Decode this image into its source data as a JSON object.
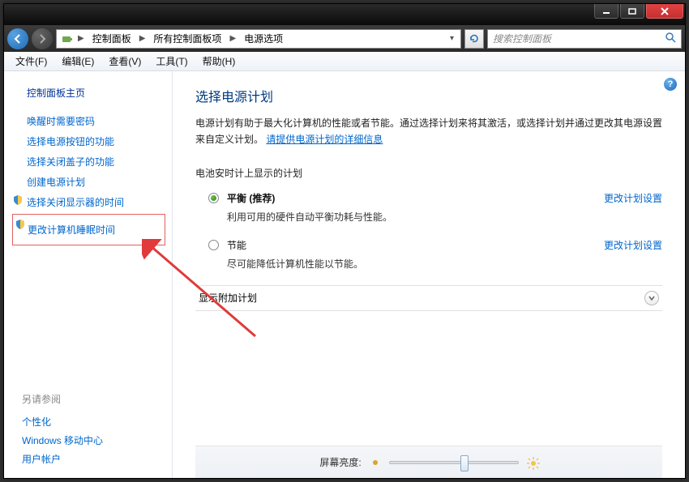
{
  "window": {
    "breadcrumb": [
      "控制面板",
      "所有控制面板项",
      "电源选项"
    ],
    "search_placeholder": "搜索控制面板"
  },
  "menu": [
    "文件(F)",
    "编辑(E)",
    "查看(V)",
    "工具(T)",
    "帮助(H)"
  ],
  "sidebar": {
    "home": "控制面板主页",
    "links": [
      "唤醒时需要密码",
      "选择电源按钮的功能",
      "选择关闭盖子的功能",
      "创建电源计划",
      "选择关闭显示器的时间"
    ],
    "highlighted": "更改计算机睡眠时间",
    "see_also_head": "另请参阅",
    "see_also": [
      "个性化",
      "Windows 移动中心",
      "用户帐户"
    ]
  },
  "content": {
    "title": "选择电源计划",
    "desc_before": "电源计划有助于最大化计算机的性能或者节能。通过选择计划来将其激活，或选择计划并通过更改其电源设置来自定义计划。",
    "desc_link": "请提供电源计划的详细信息",
    "section1": "电池安时计上显示的计划",
    "plans": [
      {
        "label": "平衡 (推荐)",
        "desc": "利用可用的硬件自动平衡功耗与性能。",
        "checked": true,
        "change": "更改计划设置"
      },
      {
        "label": "节能",
        "desc": "尽可能降低计算机性能以节能。",
        "checked": false,
        "change": "更改计划设置"
      }
    ],
    "show_more": "显示附加计划",
    "brightness_label": "屏幕亮度:"
  }
}
